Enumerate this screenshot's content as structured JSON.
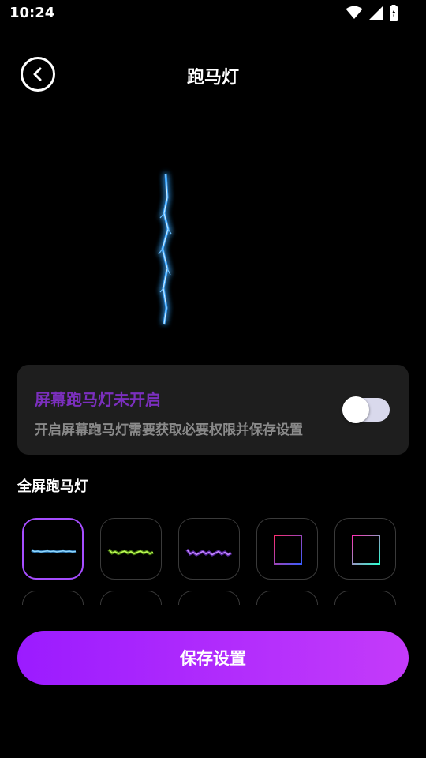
{
  "status_bar": {
    "time": "10:24",
    "icons": [
      "wifi-icon",
      "signal-icon",
      "battery-icon"
    ]
  },
  "header": {
    "title": "跑马灯",
    "back_icon": "chevron-left-icon"
  },
  "preview": {
    "effect": "blue-lightning",
    "color": "#3aa6ff"
  },
  "permission_card": {
    "title": "屏幕跑马灯未开启",
    "description": "开启屏幕跑马灯需要获取必要权限并保存设置",
    "toggle_on": false,
    "title_color": "#7b2fbe"
  },
  "section": {
    "title": "全屏跑马灯"
  },
  "effects": {
    "selected_index": 0,
    "items": [
      {
        "name": "blue-lightning",
        "colors": [
          "#3aa6ff",
          "#8fd8ff"
        ]
      },
      {
        "name": "green-flame",
        "colors": [
          "#7cd21c",
          "#c3ff5a"
        ]
      },
      {
        "name": "purple-lightning",
        "colors": [
          "#8a3cff",
          "#c88bff"
        ]
      },
      {
        "name": "magenta-blue-frame",
        "colors": [
          "#ff2d6f",
          "#3b5cff"
        ]
      },
      {
        "name": "rainbow-frame",
        "colors": [
          "#ff2db4",
          "#2dffd0"
        ]
      },
      {
        "name": "effect-6",
        "colors": [
          "#3a3a3a"
        ]
      },
      {
        "name": "effect-7",
        "colors": [
          "#3a3a3a"
        ]
      },
      {
        "name": "effect-8",
        "colors": [
          "#3a3a3a"
        ]
      },
      {
        "name": "effect-9",
        "colors": [
          "#3a3a3a"
        ]
      },
      {
        "name": "effect-10",
        "colors": [
          "#3a3a3a"
        ]
      }
    ]
  },
  "save_button": {
    "label": "保存设置",
    "gradient": [
      "#9b1bff",
      "#c43bfa"
    ]
  }
}
